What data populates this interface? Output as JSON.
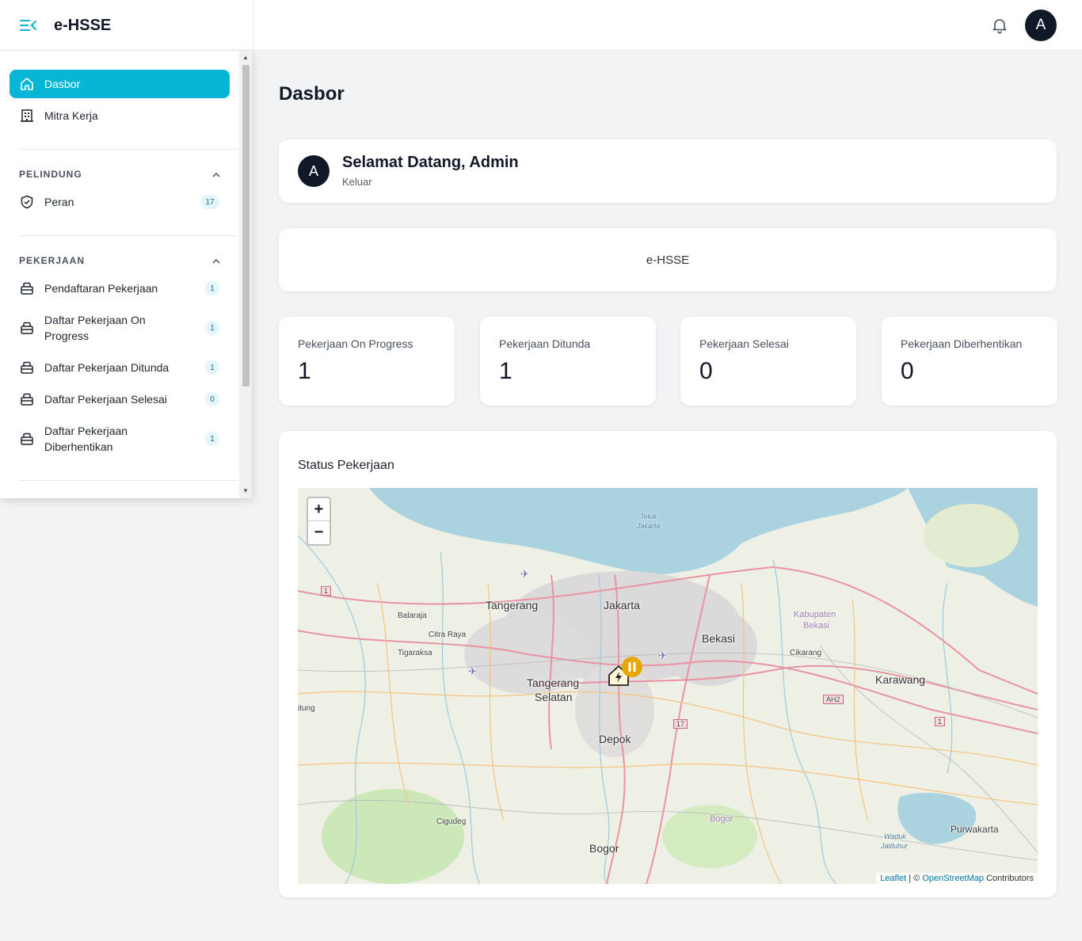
{
  "app": {
    "name": "e-HSSE"
  },
  "header": {
    "avatar_initial": "A"
  },
  "sidebar": {
    "items": [
      {
        "label": "Dasbor",
        "icon": "home-icon"
      },
      {
        "label": "Mitra Kerja",
        "icon": "building-icon"
      }
    ],
    "sections": [
      {
        "title": "PELINDUNG",
        "items": [
          {
            "label": "Peran",
            "badge": "17",
            "icon": "shield-icon"
          }
        ]
      },
      {
        "title": "PEKERJAAN",
        "items": [
          {
            "label": "Pendaftaran Pekerjaan",
            "badge": "1",
            "icon": "briefcase-icon"
          },
          {
            "label": "Daftar Pekerjaan On Progress",
            "badge": "1",
            "icon": "briefcase-icon"
          },
          {
            "label": "Daftar Pekerjaan Ditunda",
            "badge": "1",
            "icon": "briefcase-icon"
          },
          {
            "label": "Daftar Pekerjaan Selesai",
            "badge": "0",
            "icon": "briefcase-icon"
          },
          {
            "label": "Daftar Pekerjaan Diberhentikan",
            "badge": "1",
            "icon": "briefcase-icon"
          }
        ]
      }
    ]
  },
  "main": {
    "title": "Dasbor",
    "welcome": {
      "avatar_initial": "A",
      "title": "Selamat Datang, Admin",
      "logout": "Keluar"
    },
    "app_card": "e-HSSE",
    "stats": [
      {
        "label": "Pekerjaan On Progress",
        "value": "1"
      },
      {
        "label": "Pekerjaan Ditunda",
        "value": "1"
      },
      {
        "label": "Pekerjaan Selesai",
        "value": "0"
      },
      {
        "label": "Pekerjaan Diberhentikan",
        "value": "0"
      }
    ],
    "map": {
      "title": "Status Pekerjaan",
      "zoom_in": "+",
      "zoom_out": "−",
      "attribution": {
        "leaflet": "Leaflet",
        "separator": " | © ",
        "osm": "OpenStreetMap",
        "contributors": " Contributors"
      },
      "labels": {
        "jakarta": "Jakarta",
        "tangerang": "Tangerang",
        "bekasi": "Bekasi",
        "tangerang_selatan_1": "Tangerang",
        "tangerang_selatan_2": "Selatan",
        "depok": "Depok",
        "karawang": "Karawang",
        "bogor": "Bogor",
        "balaraja": "Balaraja",
        "citra_raya": "Citra Raya",
        "tigaraksa": "Tigaraksa",
        "cikarang": "Cikarang",
        "kab_bekasi_1": "Kabupaten",
        "kab_bekasi_2": "Bekasi",
        "cigudeg": "Cigudeg",
        "purwakarta": "Purwakarta",
        "bogor_regency": "Bogor",
        "teluk_1": "Teluk",
        "teluk_2": "Jakarta",
        "waduk_1": "Waduk",
        "waduk_2": "Jatiluhur",
        "itung": "itung",
        "route_1a": "1",
        "route_1b": "1",
        "route_ah2": "AH2",
        "route_17": "17"
      }
    }
  },
  "colors": {
    "accent": "#07b6d5",
    "dark": "#111827",
    "pause_marker": "#e6a700"
  }
}
